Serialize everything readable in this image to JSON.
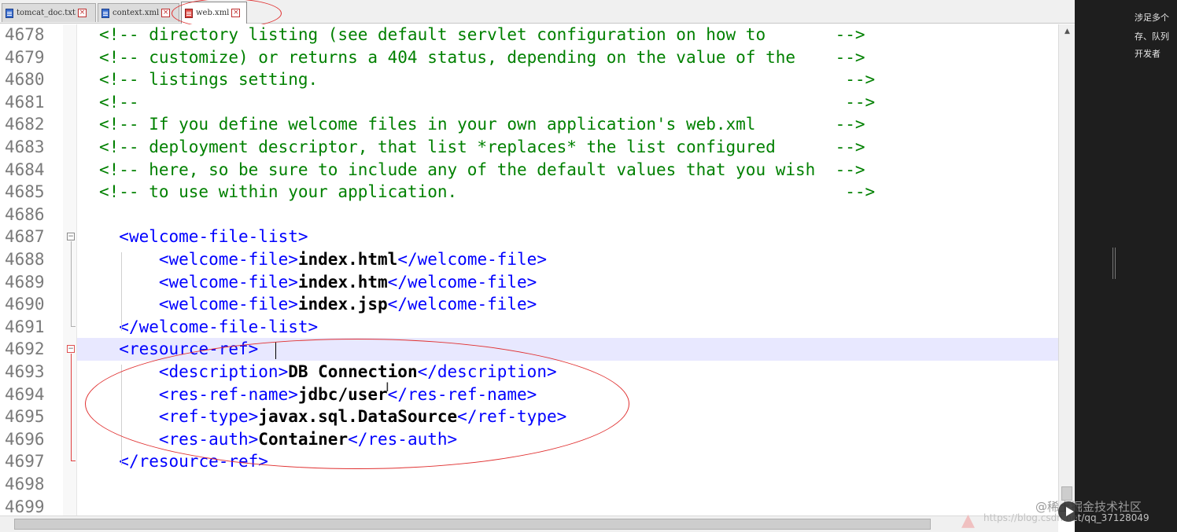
{
  "tabs": [
    {
      "label": "tomcat_doc.txt",
      "active": false
    },
    {
      "label": "context.xml",
      "active": false
    },
    {
      "label": "web.xml",
      "active": true
    }
  ],
  "lines": [
    {
      "num": "4678",
      "segments": [
        {
          "t": "<!-- directory listing (see default servlet configuration on how to       -->",
          "c": "comment"
        }
      ]
    },
    {
      "num": "4679",
      "segments": [
        {
          "t": "<!-- customize) or returns a 404 status, depending on the value of the    -->",
          "c": "comment"
        }
      ]
    },
    {
      "num": "4680",
      "segments": [
        {
          "t": "<!-- listings setting.                                                     -->",
          "c": "comment"
        }
      ]
    },
    {
      "num": "4681",
      "segments": [
        {
          "t": "<!--                                                                       -->",
          "c": "comment"
        }
      ]
    },
    {
      "num": "4682",
      "segments": [
        {
          "t": "<!-- If you define welcome files in your own application's web.xml        -->",
          "c": "comment"
        }
      ]
    },
    {
      "num": "4683",
      "segments": [
        {
          "t": "<!-- deployment descriptor, that list *replaces* the list configured      -->",
          "c": "comment"
        }
      ]
    },
    {
      "num": "4684",
      "segments": [
        {
          "t": "<!-- here, so be sure to include any of the default values that you wish  -->",
          "c": "comment"
        }
      ]
    },
    {
      "num": "4685",
      "segments": [
        {
          "t": "<!-- to use within your application.                                       -->",
          "c": "comment"
        }
      ]
    },
    {
      "num": "4686",
      "segments": []
    },
    {
      "num": "4687",
      "segments": [
        {
          "t": "  ",
          "c": "plain"
        },
        {
          "t": "<welcome-file-list>",
          "c": "tag"
        }
      ]
    },
    {
      "num": "4688",
      "segments": [
        {
          "t": "      ",
          "c": "plain"
        },
        {
          "t": "<welcome-file>",
          "c": "tag"
        },
        {
          "t": "index.html",
          "c": "text"
        },
        {
          "t": "</welcome-file>",
          "c": "tag"
        }
      ]
    },
    {
      "num": "4689",
      "segments": [
        {
          "t": "      ",
          "c": "plain"
        },
        {
          "t": "<welcome-file>",
          "c": "tag"
        },
        {
          "t": "index.htm",
          "c": "text"
        },
        {
          "t": "</welcome-file>",
          "c": "tag"
        }
      ]
    },
    {
      "num": "4690",
      "segments": [
        {
          "t": "      ",
          "c": "plain"
        },
        {
          "t": "<welcome-file>",
          "c": "tag"
        },
        {
          "t": "index.jsp",
          "c": "text"
        },
        {
          "t": "</welcome-file>",
          "c": "tag"
        }
      ]
    },
    {
      "num": "4691",
      "segments": [
        {
          "t": "  ",
          "c": "plain"
        },
        {
          "t": "</welcome-file-list>",
          "c": "tag"
        }
      ]
    },
    {
      "num": "4692",
      "segments": [
        {
          "t": "  ",
          "c": "plain"
        },
        {
          "t": "<resource-ref>",
          "c": "tag"
        }
      ]
    },
    {
      "num": "4693",
      "segments": [
        {
          "t": "      ",
          "c": "plain"
        },
        {
          "t": "<description>",
          "c": "tag"
        },
        {
          "t": "DB Connection",
          "c": "text"
        },
        {
          "t": "</description>",
          "c": "tag"
        }
      ]
    },
    {
      "num": "4694",
      "segments": [
        {
          "t": "      ",
          "c": "plain"
        },
        {
          "t": "<res-ref-name>",
          "c": "tag"
        },
        {
          "t": "jdbc/user",
          "c": "text"
        },
        {
          "t": "</res-ref-name>",
          "c": "tag"
        }
      ]
    },
    {
      "num": "4695",
      "segments": [
        {
          "t": "      ",
          "c": "plain"
        },
        {
          "t": "<ref-type>",
          "c": "tag"
        },
        {
          "t": "javax.sql.DataSource",
          "c": "text"
        },
        {
          "t": "</ref-type>",
          "c": "tag"
        }
      ]
    },
    {
      "num": "4696",
      "segments": [
        {
          "t": "      ",
          "c": "plain"
        },
        {
          "t": "<res-auth>",
          "c": "tag"
        },
        {
          "t": "Container",
          "c": "text"
        },
        {
          "t": "</res-auth>",
          "c": "tag"
        }
      ]
    },
    {
      "num": "4697",
      "segments": [
        {
          "t": "  ",
          "c": "plain"
        },
        {
          "t": "</resource-ref>",
          "c": "tag"
        }
      ]
    },
    {
      "num": "4698",
      "segments": []
    },
    {
      "num": "4699",
      "segments": []
    }
  ],
  "current_line": "4692",
  "side_panel": {
    "lines": [
      "涉足多个",
      "存、队列",
      "开发者"
    ]
  },
  "watermark": {
    "text": "@稀土掘金技术社区",
    "url_text": "https://blog.csdn.net/qq_37128049"
  },
  "colors": {
    "comment": "#008000",
    "tag": "#0000ff",
    "text": "#000000",
    "annotation": "#e03030",
    "current_line_bg": "#e8e8ff"
  }
}
